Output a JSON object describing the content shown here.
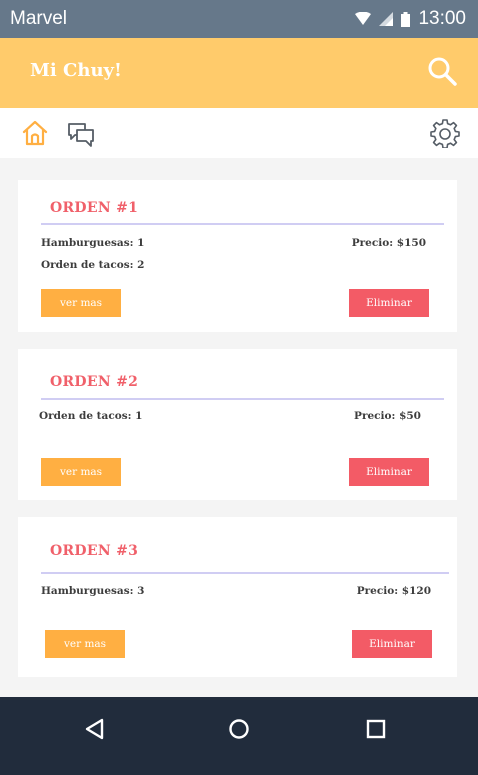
{
  "status_bar": {
    "carrier": "Marvel",
    "time": "13:00"
  },
  "app_bar": {
    "title": "Mi Chuy!"
  },
  "orders": [
    {
      "title": "ORDEN #1",
      "items": [
        "Hamburguesas: 1",
        "Orden de tacos: 2"
      ],
      "price": "Precio: $150",
      "more_label": "ver mas",
      "delete_label": "Eliminar"
    },
    {
      "title": "ORDEN #2",
      "items": [
        "Orden de tacos: 1"
      ],
      "price": "Precio: $50",
      "more_label": "ver mas",
      "delete_label": "Eliminar"
    },
    {
      "title": "ORDEN #3",
      "items": [
        "Hamburguesas: 3"
      ],
      "price": "Precio: $120",
      "more_label": "ver mas",
      "delete_label": "Eliminar"
    }
  ],
  "colors": {
    "app_bar": "#ffcb6b",
    "title_red": "#f0606a",
    "more_button": "#ffaf42",
    "delete_button": "#f35b66",
    "nav_bar": "#212c3c",
    "status_bar": "#66788a"
  },
  "icons": {
    "tabs": [
      "home-icon",
      "chat-icon",
      "settings-icon"
    ],
    "search": "search-icon",
    "nav": [
      "back-icon",
      "home-circle-icon",
      "recents-icon"
    ]
  }
}
